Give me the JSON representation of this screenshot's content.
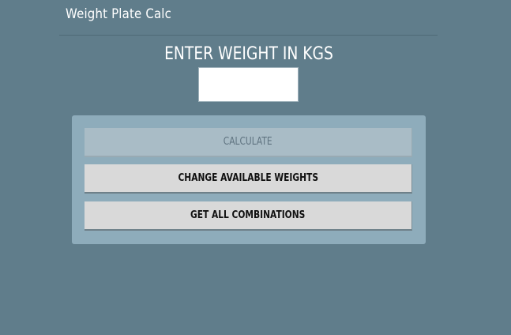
{
  "header": {
    "title": "Weight Plate Calc"
  },
  "main": {
    "prompt": "ENTER WEIGHT IN KGS",
    "weight_input": {
      "value": "",
      "placeholder": ""
    },
    "buttons": {
      "calculate": "CALCULATE",
      "change_weights": "CHANGE AVAILABLE WEIGHTS",
      "all_combinations": "GET ALL COMBINATIONS"
    }
  },
  "colors": {
    "background": "#607d8b",
    "panel": "#8eacbb",
    "button": "#d9d9d9",
    "button_disabled": "#a9bcc6"
  }
}
